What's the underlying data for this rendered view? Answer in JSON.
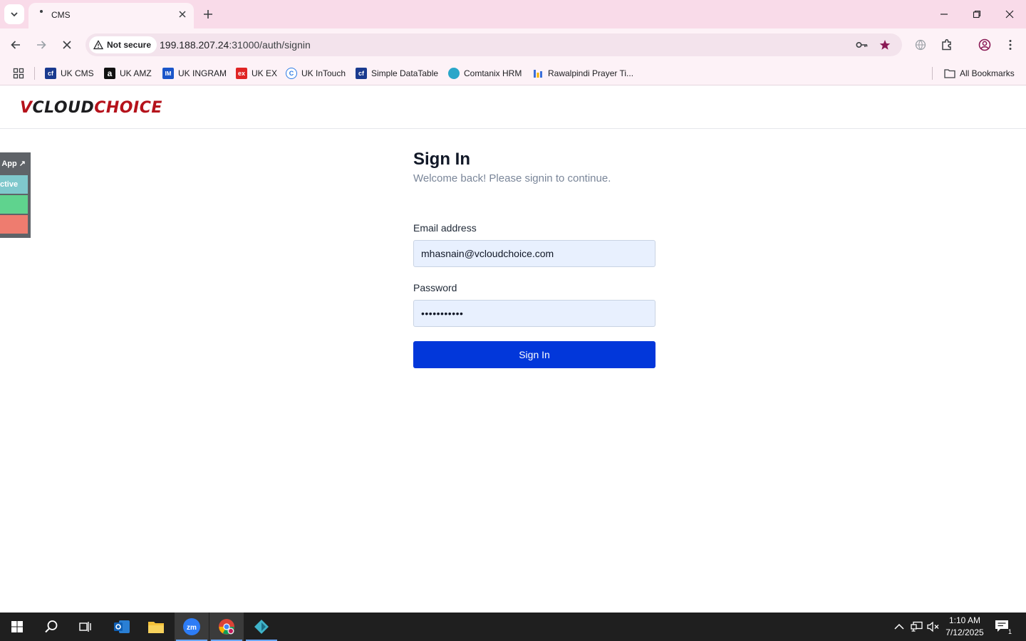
{
  "browser": {
    "tab_title": "CMS",
    "not_secure_label": "Not secure",
    "url_host": "199.188.207.24",
    "url_rest": ":31000/auth/signin"
  },
  "bookmarks": [
    {
      "label": "UK CMS",
      "icon": "cms-favicon",
      "color": "#1a3a8f",
      "glyph": "cf"
    },
    {
      "label": "UK AMZ",
      "icon": "amazon-favicon",
      "color": "#111111",
      "glyph": "a"
    },
    {
      "label": "UK INGRAM",
      "icon": "ingram-favicon",
      "color": "#1a55c9",
      "glyph": "IM"
    },
    {
      "label": "UK EX",
      "icon": "ex-favicon",
      "color": "#e02424",
      "glyph": "ex"
    },
    {
      "label": "UK InTouch",
      "icon": "intouch-favicon",
      "color": "#2c7be5",
      "glyph": "C"
    },
    {
      "label": "Simple DataTable",
      "icon": "datatable-favicon",
      "color": "#1a3a8f",
      "glyph": "cf"
    },
    {
      "label": "Comtanix HRM",
      "icon": "comtanix-favicon",
      "color": "#2aa6c9",
      "glyph": ""
    },
    {
      "label": "Rawalpindi Prayer Ti...",
      "icon": "prayer-favicon",
      "color": "#3b6fd8",
      "glyph": ""
    }
  ],
  "all_bookmarks_label": "All Bookmarks",
  "logo": {
    "part1": "V",
    "part2": "CLOUD",
    "part3": "CHOICE"
  },
  "float_panel": {
    "app_label": "App ↗",
    "active_label": "ctive"
  },
  "signin": {
    "title": "Sign In",
    "subtitle": "Welcome back! Please signin to continue.",
    "email_label": "Email address",
    "email_value": "mhasnain@vcloudchoice.com",
    "password_label": "Password",
    "password_value": "•••••••••••",
    "button_label": "Sign In"
  },
  "taskbar": {
    "time": "1:10 AM",
    "date": "7/12/2025",
    "notification_count": "1"
  },
  "colors": {
    "primary_button": "#0237da",
    "logo_red": "#b5121b"
  }
}
